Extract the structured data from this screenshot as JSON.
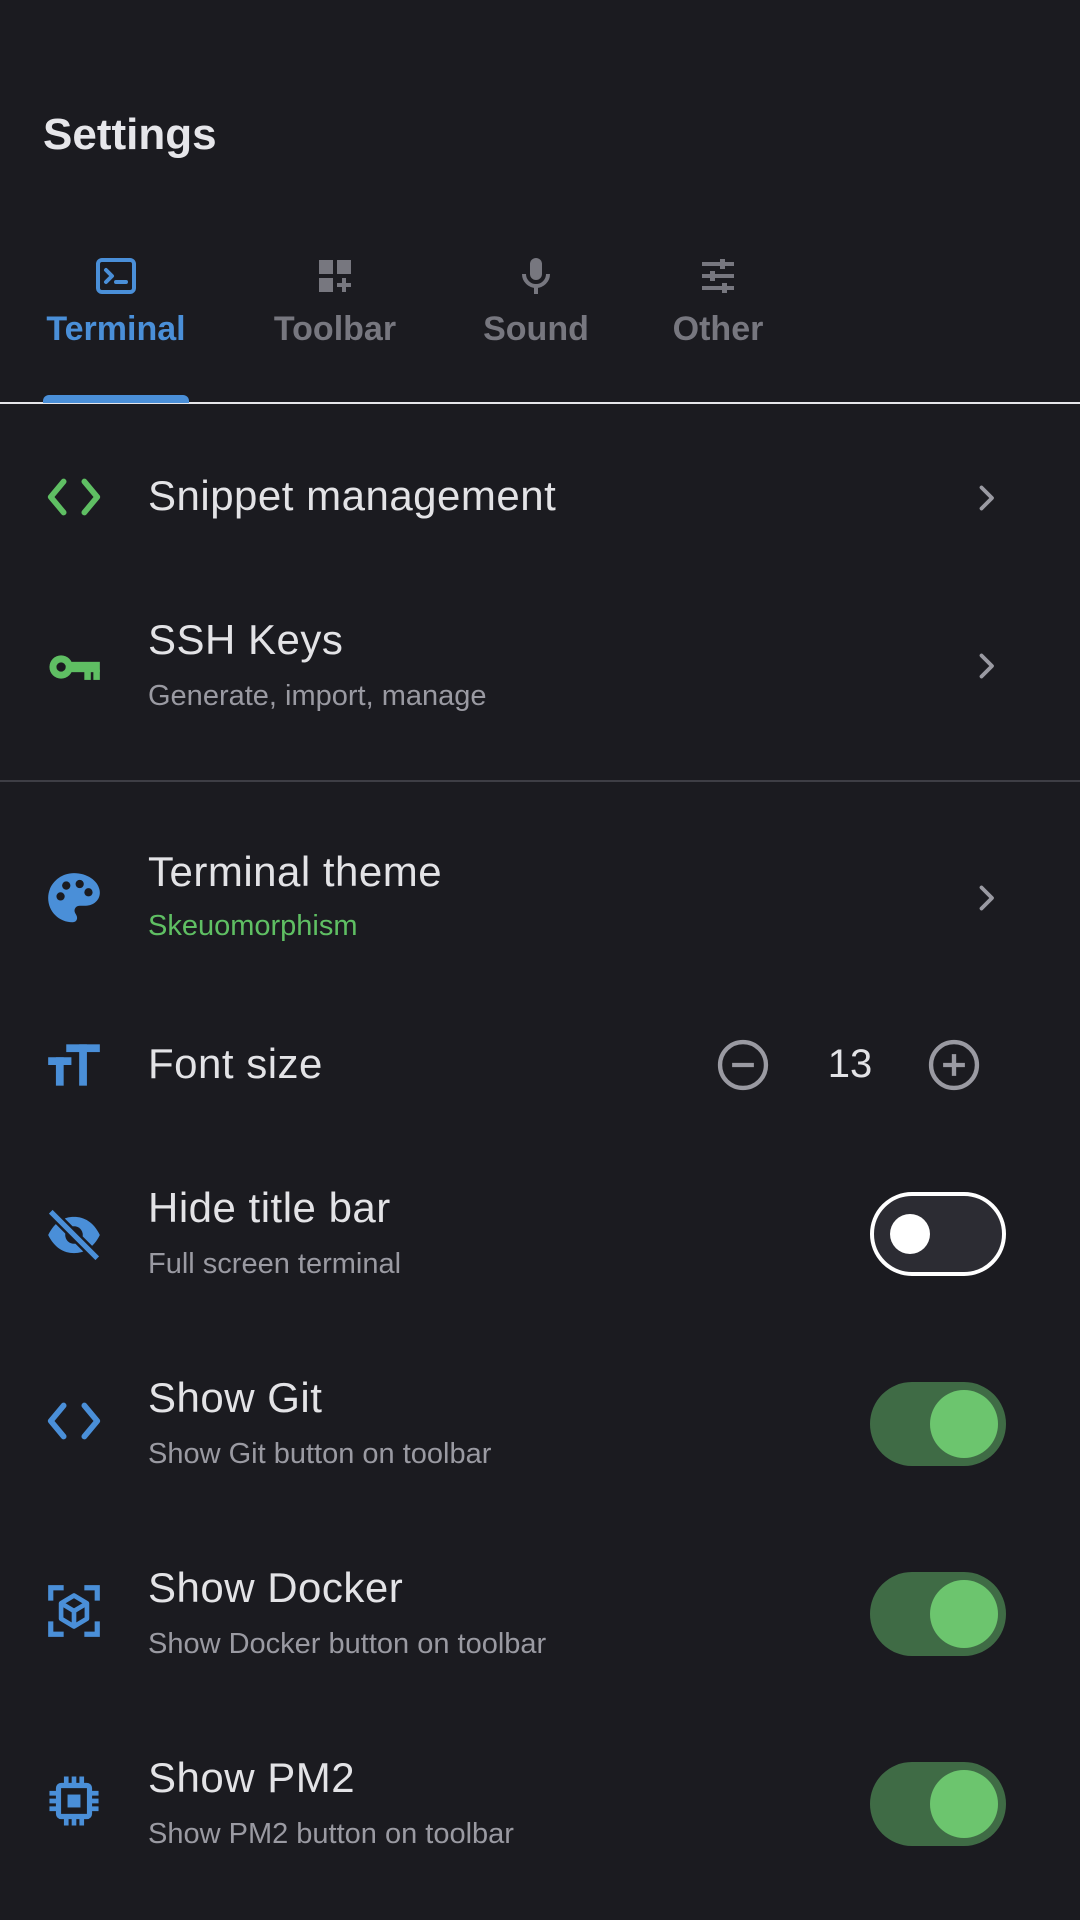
{
  "header": {
    "title": "Settings"
  },
  "tabs": [
    {
      "label": "Terminal",
      "icon": "terminal-icon",
      "active": true
    },
    {
      "label": "Toolbar",
      "icon": "dashboard-add-icon",
      "active": false
    },
    {
      "label": "Sound",
      "icon": "microphone-icon",
      "active": false
    },
    {
      "label": "Other",
      "icon": "sliders-icon",
      "active": false
    }
  ],
  "rows": {
    "snippet": {
      "title": "Snippet management",
      "icon": "code-icon"
    },
    "ssh": {
      "title": "SSH Keys",
      "subtitle": "Generate, import, manage",
      "icon": "key-icon"
    },
    "theme": {
      "title": "Terminal theme",
      "subtitle": "Skeuomorphism",
      "icon": "palette-icon"
    },
    "font": {
      "title": "Font size",
      "value": "13",
      "icon": "text-size-icon"
    },
    "hide_title": {
      "title": "Hide title bar",
      "subtitle": "Full screen terminal",
      "enabled": false,
      "icon": "eye-off-icon"
    },
    "git": {
      "title": "Show Git",
      "subtitle": "Show Git button on toolbar",
      "enabled": true,
      "icon": "code-icon"
    },
    "docker": {
      "title": "Show Docker",
      "subtitle": "Show Docker button on toolbar",
      "enabled": true,
      "icon": "cube-scan-icon"
    },
    "pm2": {
      "title": "Show PM2",
      "subtitle": "Show PM2 button on toolbar",
      "enabled": true,
      "icon": "chip-icon"
    }
  },
  "colors": {
    "background": "#1b1b20",
    "accent_blue": "#4a8fd8",
    "accent_green": "#5fbf63",
    "switch_on_track": "#3f6b45",
    "switch_on_knob": "#6cc56e"
  }
}
